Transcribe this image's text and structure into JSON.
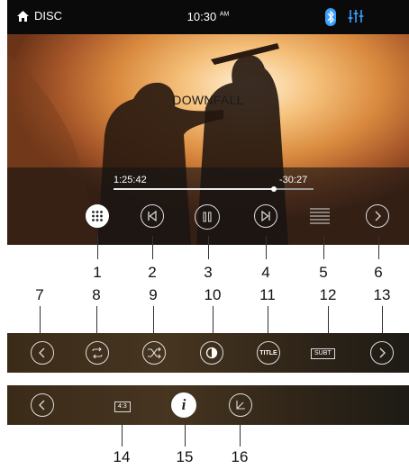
{
  "status_bar": {
    "source": "DISC",
    "time": "10:30",
    "meridiem": "AM"
  },
  "video": {
    "title": "DOWNFALL"
  },
  "playback": {
    "elapsed": "1:25:42",
    "remaining": "-30:27",
    "progress_fraction": 0.8
  },
  "strip2": {
    "title_label": "TITLE",
    "subtitle_label": "SUBT"
  },
  "strip3": {
    "aspect_label": "4:3"
  },
  "callouts": {
    "row1": [
      "1",
      "2",
      "3",
      "4",
      "5",
      "6"
    ],
    "row2": [
      "7",
      "8",
      "9",
      "10",
      "11",
      "12",
      "13"
    ],
    "row3": [
      "14",
      "15",
      "16"
    ]
  },
  "icons": {
    "home": "home-icon",
    "bluetooth": "bluetooth-icon",
    "equalizer": "equalizer-icon",
    "menu": "grid-menu-icon",
    "previous": "skip-previous-icon",
    "pause": "pause-icon",
    "next": "skip-next-icon",
    "list": "list-icon",
    "more": "chevron-right-icon",
    "back": "chevron-left-icon",
    "repeat": "repeat-icon",
    "shuffle": "shuffle-icon",
    "contrast": "contrast-icon",
    "info": "info-icon",
    "angle": "angle-icon"
  },
  "colors": {
    "accent": "#3aa0ff",
    "status_bar": "#0a0a0a"
  }
}
